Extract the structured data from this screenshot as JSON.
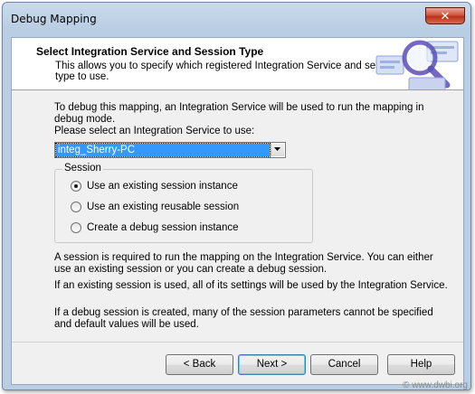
{
  "window": {
    "title": "Debug Mapping",
    "close_glyph": "✕"
  },
  "header": {
    "title": "Select Integration Service and Session Type",
    "description": "This allows you to specify which registered Integration Service and session type to use."
  },
  "intro": {
    "line1": "To debug this mapping, an Integration Service will be used to run the mapping in debug mode.",
    "line2": "Please select an Integration Service to use:"
  },
  "service_select": {
    "selected": "integ_Sherry-PC"
  },
  "session_group": {
    "label": "Session",
    "options": [
      {
        "label": "Use an existing session instance",
        "checked": true
      },
      {
        "label": "Use an existing reusable session",
        "checked": false
      },
      {
        "label": "Create a debug session instance",
        "checked": false
      }
    ]
  },
  "notes": {
    "p1": "A session is required to run the mapping on the Integration Service.  You can either use an existing session or you can create a debug session.",
    "p2": "If an existing session is used, all of its settings will be used by the Integration Service.",
    "p3": "If a debug session is created, many of the session parameters cannot be specified and default values will be used."
  },
  "buttons": {
    "back": "< Back",
    "next": "Next >",
    "cancel": "Cancel",
    "help": "Help"
  },
  "watermark": "© www.dwbi.org",
  "colors": {
    "selection": "#3399ff",
    "close": "#c8402a"
  }
}
